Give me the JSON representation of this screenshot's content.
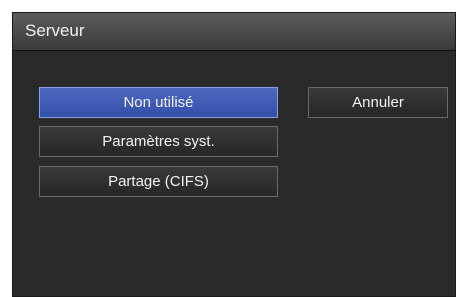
{
  "dialog": {
    "title": "Serveur"
  },
  "options": [
    {
      "label": "Non utilisé",
      "selected": true
    },
    {
      "label": "Paramètres syst.",
      "selected": false
    },
    {
      "label": "Partage (CIFS)",
      "selected": false
    }
  ],
  "cancel_label": "Annuler",
  "colors": {
    "selected_button": "#3f5bb5",
    "dialog_background": "#2a2a2a",
    "titlebar": "#4a4a4a"
  }
}
